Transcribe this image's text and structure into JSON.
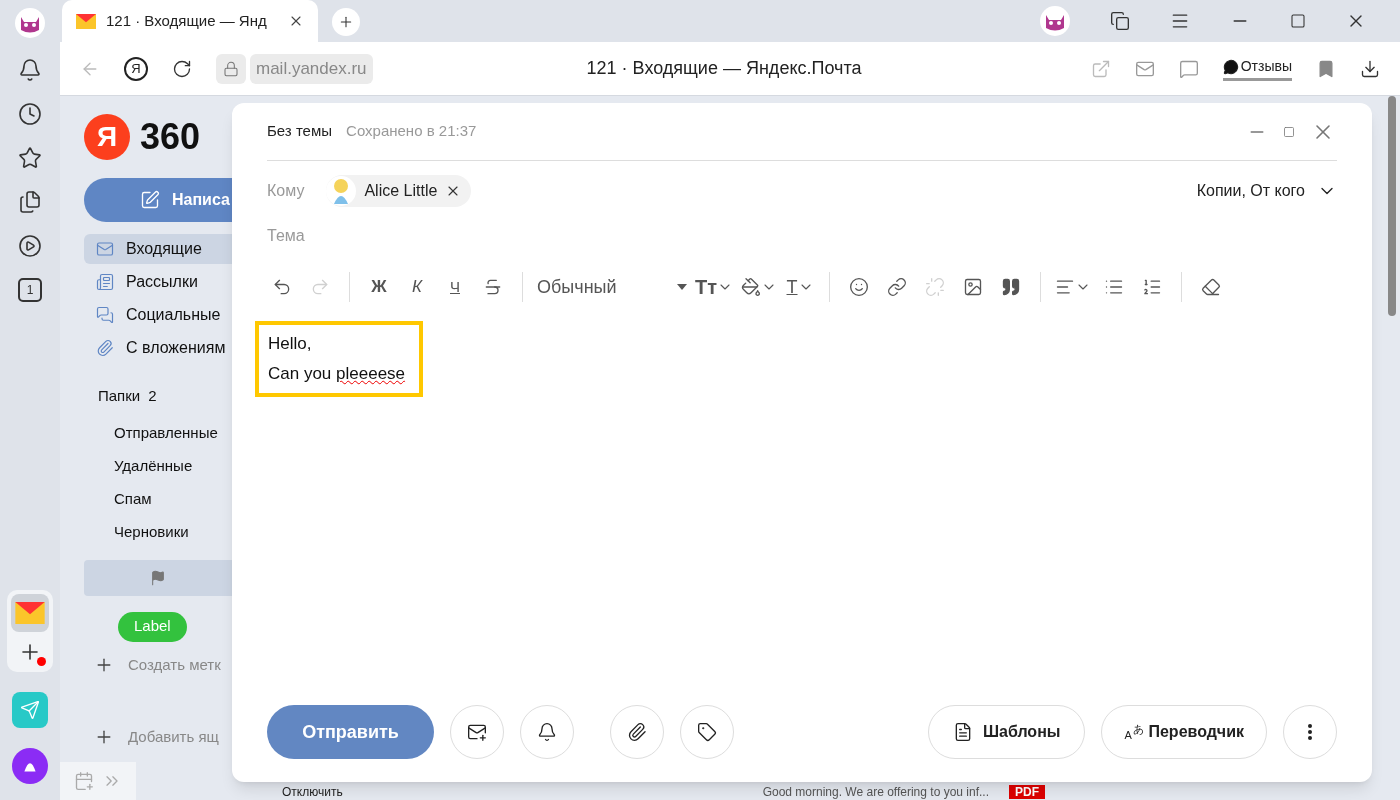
{
  "browser": {
    "tab": {
      "title": "121 · Входящие — Янд",
      "selected": true
    },
    "address": {
      "url": "mail.yandex.ru",
      "ya_letter": "Я"
    },
    "page_title": "121 · Входящие — Яндекс.Почта",
    "feedback": "Отзывы",
    "side_badge": "1"
  },
  "mail_sidebar": {
    "logo_letter": "Я",
    "logo_text": "360",
    "compose": "Написа",
    "items": [
      {
        "kind": "inbox",
        "label": "Входящие",
        "selected": true
      },
      {
        "kind": "newsletters",
        "label": "Рассылки",
        "selected": false
      },
      {
        "kind": "social",
        "label": "Социальные",
        "selected": false
      },
      {
        "kind": "attachments",
        "label": "С вложениям",
        "selected": false
      }
    ],
    "folders_header": "Папки",
    "folders_count": "2",
    "folders": [
      {
        "label": "Отправленные"
      },
      {
        "label": "Удалённые"
      },
      {
        "label": "Спам"
      },
      {
        "label": "Черновики"
      }
    ],
    "label_tag": {
      "text": "Label",
      "color": "#33c23e"
    },
    "create_label": "Создать метк",
    "add_mailbox": "Добавить ящ"
  },
  "background_row": {
    "action": "Отключить",
    "snippet": "Good morning. We are offering to you inf...",
    "badge": "PDF"
  },
  "compose": {
    "title": "Без темы",
    "saved": "Сохранено в 21:37",
    "to_label": "Кому",
    "recipients": [
      {
        "name": "Alice Little"
      }
    ],
    "copies": "Копии, От кого",
    "subject_placeholder": "Тема",
    "toolbar": {
      "undo": {
        "disabled": false
      },
      "redo": {
        "disabled": true
      },
      "bold": "Ж",
      "italic": "К",
      "underline": "Ч",
      "style": "Обычный",
      "font_size": "Tт",
      "text_color": "T",
      "link": {
        "disabled": false
      },
      "unlink": {
        "disabled": true
      }
    },
    "body": {
      "highlighted": true,
      "lines": [
        [
          {
            "text": "Hello,",
            "misspelled": false
          }
        ],
        [
          {
            "text": "Can you ",
            "misspelled": false
          },
          {
            "text": "pleeeese",
            "misspelled": true
          }
        ]
      ]
    },
    "send": "Отправить",
    "templates": "Шаблоны",
    "translator": {
      "label": "Переводчик",
      "icon_letters": [
        "A",
        "あ"
      ]
    }
  }
}
